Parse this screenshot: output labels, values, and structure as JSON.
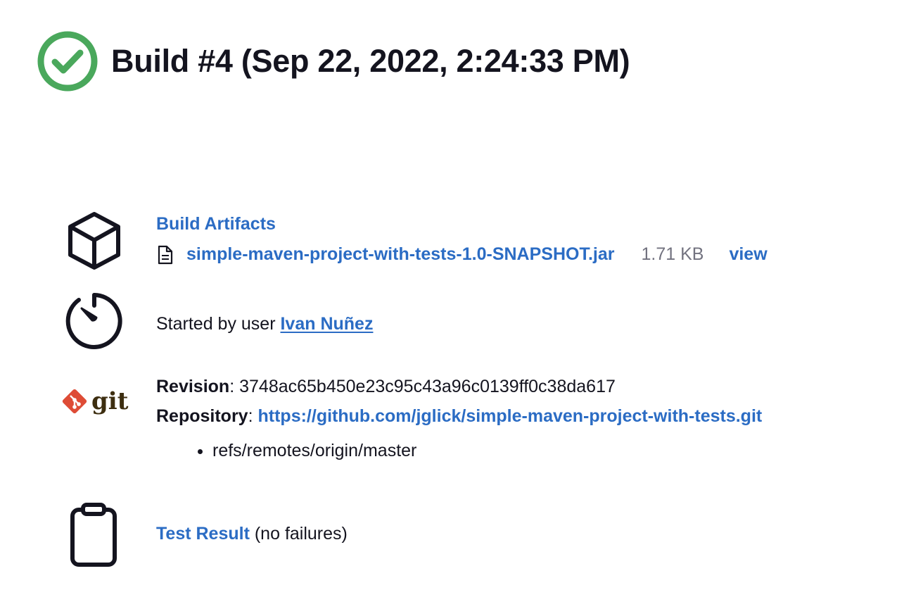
{
  "build": {
    "title": "Build #4 (Sep 22, 2022, 2:24:33 PM)",
    "status_icon": "success-check-icon",
    "status_color": "#4aa85c"
  },
  "artifacts": {
    "icon": "package-cube-icon",
    "section_label": "Build Artifacts",
    "items": [
      {
        "file_icon": "file-icon",
        "name": "simple-maven-project-with-tests-1.0-SNAPSHOT.jar",
        "size": "1.71 KB",
        "view_label": "view"
      }
    ]
  },
  "cause": {
    "icon": "timer-icon",
    "text": "Started by user ",
    "user": "Ivan Nuñez"
  },
  "scm": {
    "icon": "git-logo-icon",
    "logo_text": "git",
    "logo_color": "#de4c36",
    "revision_label": "Revision",
    "revision": "3748ac65b450e23c95c43a96c0139ff0c38da617",
    "repository_label": "Repository",
    "repository_url": "https://github.com/jglick/simple-maven-project-with-tests.git",
    "branches": [
      "refs/remotes/origin/master"
    ]
  },
  "tests": {
    "icon": "clipboard-icon",
    "link_label": "Test Result",
    "summary": "(no failures)"
  },
  "colors": {
    "link": "#2b6cc4",
    "text": "#14141f",
    "muted": "#72727f"
  }
}
